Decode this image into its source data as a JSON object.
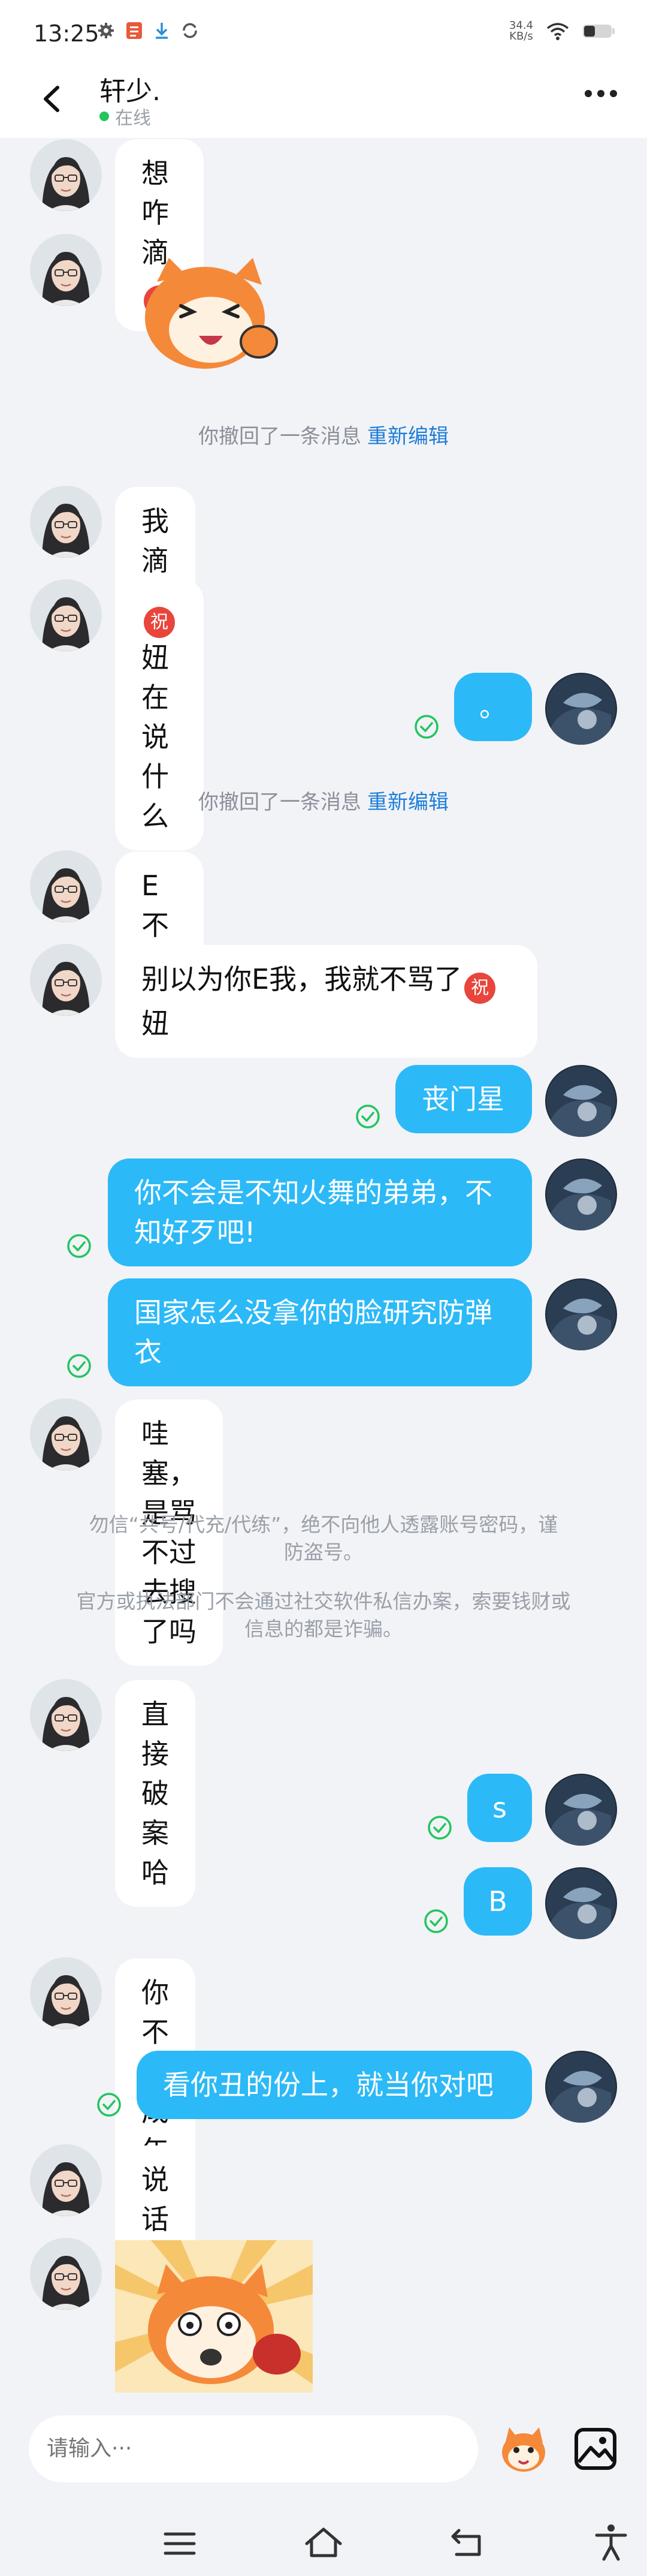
{
  "status_bar": {
    "time": "13:25",
    "net_speed_value": "34.4",
    "net_speed_unit": "KB/s"
  },
  "header": {
    "title": "轩少.",
    "status": "在线"
  },
  "messages": [
    {
      "side": "left",
      "text": "想咋滴"
    },
    {
      "side": "left",
      "type": "sticker"
    },
    {
      "side": "left",
      "text": "我滴妈"
    },
    {
      "side": "left",
      "text": "妞在说什么"
    },
    {
      "side": "right",
      "text": "。"
    },
    {
      "side": "left",
      "text": "E不E"
    },
    {
      "side": "left",
      "text_line1": "别以为你E我，我就不骂了",
      "text_line2": "妞"
    },
    {
      "side": "right",
      "text": "丧门星"
    },
    {
      "side": "right",
      "text_line1": "你不会是不知火舞的弟弟，不",
      "text_line2": "知好歹吧!"
    },
    {
      "side": "right",
      "text_line1": "国家怎么没拿你的脸研究防弹",
      "text_line2": "衣"
    },
    {
      "side": "left",
      "text": "哇塞，是骂不过去搜了吗"
    },
    {
      "side": "left",
      "text": "直接破案哈"
    },
    {
      "side": "right",
      "text": "s"
    },
    {
      "side": "right",
      "text": "B"
    },
    {
      "side": "left",
      "text": "你不是成年了吗"
    },
    {
      "side": "right",
      "text": "看你丑的份上，就当你对吧"
    },
    {
      "side": "left",
      "text": "说话怎么像小孩子"
    },
    {
      "side": "left",
      "type": "sticker"
    }
  ],
  "emoji_char": "祝",
  "recall_notice": {
    "text": "你撤回了一条消息",
    "action": "重新编辑"
  },
  "safety_notice": {
    "line1": "勿信“共号/代充/代练”，绝不向他人透露账号密码，谨",
    "line2": "防盗号。",
    "line3": "官方或执法部门不会通过社交软件私信办案，索要钱财或",
    "line4": "信息的都是诈骗。"
  },
  "input": {
    "placeholder": "请输入···"
  },
  "colors": {
    "accent_bubble": "#2cb9f7",
    "link": "#1f7ed8",
    "check": "#22c55e",
    "background": "#f2f3f7"
  },
  "icons": {
    "back": "back-arrow-icon",
    "more": "more-dots-icon",
    "sticker": "sticker-icon",
    "image": "image-icon",
    "nav_menu": "menu-icon",
    "nav_home": "home-icon",
    "nav_back": "return-icon",
    "nav_accessibility": "accessibility-icon"
  }
}
